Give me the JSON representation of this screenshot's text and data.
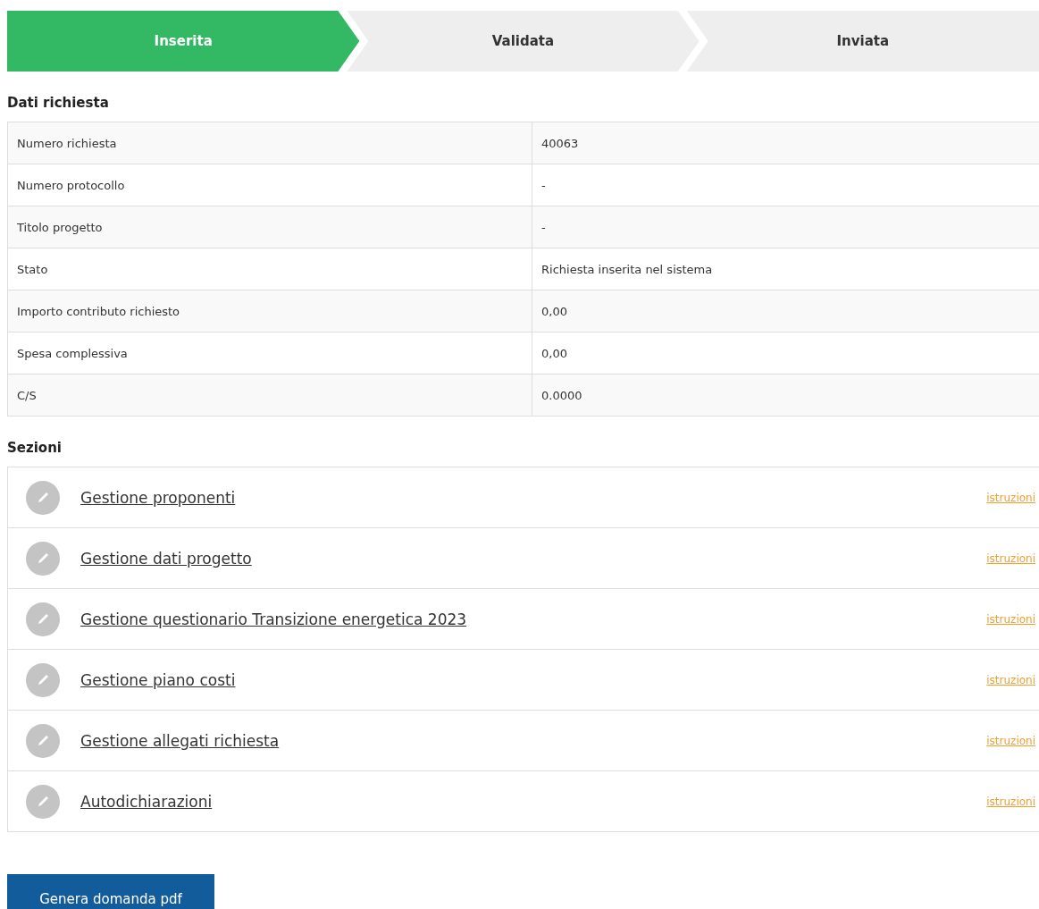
{
  "steps": [
    {
      "label": "Inserita",
      "selected": true
    },
    {
      "label": "Validata",
      "selected": false
    },
    {
      "label": "Inviata",
      "selected": false
    }
  ],
  "request_data": {
    "title": "Dati richiesta",
    "rows": [
      {
        "label": "Numero richiesta",
        "value": "40063"
      },
      {
        "label": "Numero protocollo",
        "value": "-"
      },
      {
        "label": "Titolo progetto",
        "value": "-"
      },
      {
        "label": "Stato",
        "value": "Richiesta inserita nel sistema"
      },
      {
        "label": "Importo contributo richiesto",
        "value": "0,00"
      },
      {
        "label": "Spesa complessiva",
        "value": "0,00"
      },
      {
        "label": "C/S",
        "value": "0.0000"
      }
    ]
  },
  "sections": {
    "title": "Sezioni",
    "items": [
      {
        "label": "Gestione proponenti",
        "help": "istruzioni"
      },
      {
        "label": "Gestione dati progetto",
        "help": "istruzioni"
      },
      {
        "label": "Gestione questionario Transizione energetica 2023",
        "help": "istruzioni"
      },
      {
        "label": "Gestione piano costi",
        "help": "istruzioni"
      },
      {
        "label": "Gestione allegati richiesta",
        "help": "istruzioni"
      },
      {
        "label": "Autodichiarazioni",
        "help": "istruzioni"
      }
    ]
  },
  "button": "Genera domanda pdf"
}
